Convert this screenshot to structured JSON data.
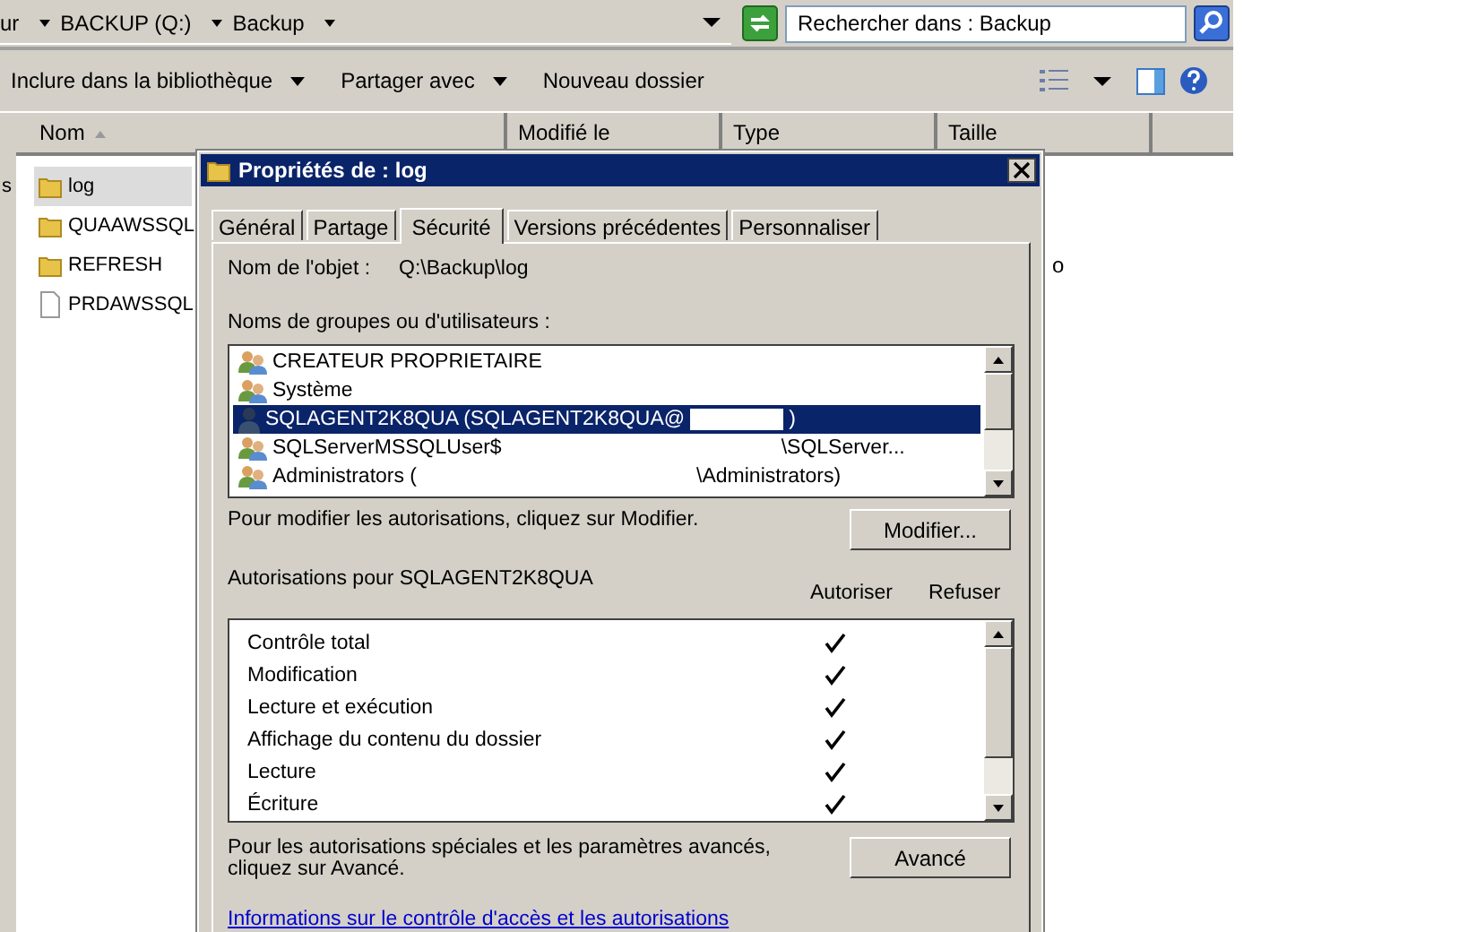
{
  "explorer": {
    "breadcrumb": [
      {
        "label": "ur"
      },
      {
        "label": "BACKUP (Q:)"
      },
      {
        "label": "Backup"
      }
    ],
    "search": {
      "placeholder": "Rechercher dans : Backup"
    },
    "toolbar": [
      {
        "label": "Inclure dans la bibliothèque",
        "dropdown": true
      },
      {
        "label": "Partager avec",
        "dropdown": true
      },
      {
        "label": "Nouveau dossier",
        "dropdown": false
      }
    ],
    "nav_fragment": "s",
    "columns": [
      "Nom",
      "Modifié le",
      "Type",
      "Taille"
    ],
    "files": [
      {
        "name": "log",
        "kind": "folder",
        "selected": true
      },
      {
        "name": "QUAAWSSQL",
        "kind": "folder",
        "selected": false
      },
      {
        "name": "REFRESH",
        "kind": "folder",
        "selected": false,
        "column_3": "o"
      },
      {
        "name": "PRDAWSSQL",
        "kind": "file",
        "selected": false
      }
    ]
  },
  "dialog": {
    "title": "Propriétés de : log",
    "tabs": [
      {
        "label": "Général",
        "selected": false
      },
      {
        "label": "Partage",
        "selected": false
      },
      {
        "label": "Sécurité",
        "selected": true
      },
      {
        "label": "Versions précédentes",
        "selected": false
      },
      {
        "label": "Personnaliser",
        "selected": false
      }
    ],
    "object_label": "Nom de l'objet :",
    "object_value": "Q:\\Backup\\log",
    "groups_label": "Noms de groupes ou d'utilisateurs :",
    "groups": [
      {
        "name": "CREATEUR PROPRIETAIRE",
        "kind": "group",
        "selected": false
      },
      {
        "name": "Système",
        "kind": "group",
        "selected": false
      },
      {
        "name": "SQLAGENT2K8QUA (SQLAGENT2K8QUA@",
        "tail": ")",
        "kind": "user",
        "selected": true
      },
      {
        "name": "SQLServerMSSQLUser$",
        "tail": "\\SQLServer...",
        "kind": "group",
        "selected": false
      },
      {
        "name": "Administrators (",
        "tail": "\\Administrators)",
        "kind": "group",
        "selected": false
      }
    ],
    "modify_hint": "Pour modifier les autorisations, cliquez sur Modifier.",
    "modify_button": "Modifier...",
    "permissions_label": "Autorisations pour SQLAGENT2K8QUA",
    "allow_label": "Autoriser",
    "deny_label": "Refuser",
    "permissions": [
      {
        "name": "Contrôle total",
        "allow": true,
        "deny": false
      },
      {
        "name": "Modification",
        "allow": true,
        "deny": false
      },
      {
        "name": "Lecture et exécution",
        "allow": true,
        "deny": false
      },
      {
        "name": "Affichage du contenu du dossier",
        "allow": true,
        "deny": false
      },
      {
        "name": "Lecture",
        "allow": true,
        "deny": false
      },
      {
        "name": "Écriture",
        "allow": true,
        "deny": false
      }
    ],
    "advanced_hint": "Pour les autorisations spéciales et les paramètres avancés, cliquez sur Avancé.",
    "advanced_button": "Avancé",
    "help_link": "Informations sur le contrôle d'accès et les autorisations"
  }
}
